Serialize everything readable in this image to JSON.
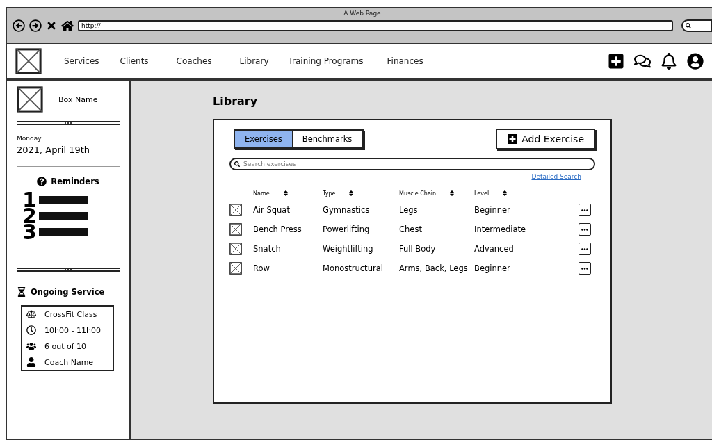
{
  "window": {
    "title": "A Web Page",
    "address": "http://"
  },
  "nav": {
    "items": [
      "Services",
      "Clients",
      "Coaches",
      "Library",
      "Training Programs",
      "Finances"
    ]
  },
  "sidebar": {
    "box_name": "Box Name",
    "day": "Monday",
    "date": "2021, April 19th",
    "reminders_title": "Reminders",
    "reminders": [
      "1",
      "2",
      "3"
    ],
    "service_title": "Ongoing Service",
    "service": [
      {
        "kind": "class",
        "text": "CrossFit Class"
      },
      {
        "kind": "time",
        "text": "10h00 - 11h00"
      },
      {
        "kind": "people",
        "text": "6 out of 10"
      },
      {
        "kind": "coach",
        "text": "Coach Name"
      }
    ]
  },
  "page": {
    "title": "Library"
  },
  "tabs": [
    {
      "label": "Exercises",
      "selected": true
    },
    {
      "label": "Benchmarks",
      "selected": false
    }
  ],
  "add_button": "Add Exercise",
  "search": {
    "placeholder": "Search exercises"
  },
  "detailed_search": "Detailed Search",
  "table": {
    "columns": [
      "Name",
      "Type",
      "Muscle Chain",
      "Level"
    ],
    "rows": [
      [
        "Air Squat",
        "Gymnastics",
        "Legs",
        "Beginner"
      ],
      [
        "Bench Press",
        "Powerlifting",
        "Chest",
        "Intermediate"
      ],
      [
        "Snatch",
        "Weightlifting",
        "Full Body",
        "Advanced"
      ],
      [
        "Row",
        "Monostructural",
        "Arms, Back, Legs",
        "Beginner"
      ]
    ]
  }
}
